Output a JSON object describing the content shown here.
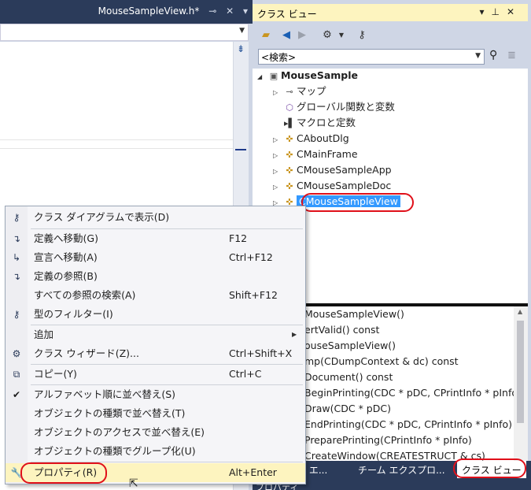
{
  "editor": {
    "tab_title": "MouseSampleView.h*",
    "pin_icon": "pin-icon",
    "close_icon": "close-icon"
  },
  "class_view": {
    "title": "クラス ビュー",
    "search_value": "<検索>",
    "tree": [
      {
        "label": "MouseSample",
        "icon": "project-icon"
      },
      {
        "label": "マップ",
        "icon": "key-icon"
      },
      {
        "label": "グローバル関数と変数",
        "icon": "cube-icon"
      },
      {
        "label": "マクロと定数",
        "icon": "macro-icon"
      },
      {
        "label": "CAboutDlg",
        "icon": "class-icon"
      },
      {
        "label": "CMainFrame",
        "icon": "class-icon"
      },
      {
        "label": "CMouseSampleApp",
        "icon": "class-icon"
      },
      {
        "label": "CMouseSampleDoc",
        "icon": "class-icon"
      },
      {
        "label": "CMouseSampleView",
        "icon": "class-icon"
      }
    ],
    "members": [
      "MouseSampleView()",
      "ertValid() const",
      "ouseSampleView()",
      "mp(CDumpContext & dc) const",
      "Document() const",
      "BeginPrinting(CDC * pDC, CPrintInfo * pInfo)",
      "Draw(CDC * pDC)",
      "EndPrinting(CDC * pDC, CPrintInfo * pInfo)",
      "PreparePrinting(CPrintInfo * pInfo)",
      "CreateWindow(CREATESTRUCT & cs)"
    ],
    "bottom_tabs": [
      "ョン エ...",
      "チーム エクスプロ...",
      "クラス ビュー"
    ],
    "properties_title": "プロパティ"
  },
  "context_menu": {
    "items": [
      {
        "label": "クラス ダイアグラムで表示(D)",
        "shortcut": "",
        "icon": "class-diagram-icon"
      },
      {
        "label": "定義へ移動(G)",
        "shortcut": "F12",
        "icon": "go-to-definition-icon"
      },
      {
        "label": "宣言へ移動(A)",
        "shortcut": "Ctrl+F12",
        "icon": "go-to-declaration-icon"
      },
      {
        "label": "定義の参照(B)",
        "shortcut": "",
        "icon": "browse-definition-icon"
      },
      {
        "label": "すべての参照の検索(A)",
        "shortcut": "Shift+F12",
        "icon": ""
      },
      {
        "label": "型のフィルター(I)",
        "shortcut": "",
        "icon": "type-filter-icon"
      },
      {
        "label": "追加",
        "shortcut": "",
        "icon": ""
      },
      {
        "label": "クラス ウィザード(Z)...",
        "shortcut": "Ctrl+Shift+X",
        "icon": "class-wizard-icon"
      },
      {
        "label": "コピー(Y)",
        "shortcut": "Ctrl+C",
        "icon": "copy-icon"
      },
      {
        "label": "アルファベット順に並べ替え(S)",
        "shortcut": "",
        "icon": "checkmark-icon"
      },
      {
        "label": "オブジェクトの種類で並べ替え(T)",
        "shortcut": "",
        "icon": ""
      },
      {
        "label": "オブジェクトのアクセスで並べ替え(E)",
        "shortcut": "",
        "icon": ""
      },
      {
        "label": "オブジェクトの種類でグループ化(U)",
        "shortcut": "",
        "icon": ""
      },
      {
        "label": "プロパティ(R)",
        "shortcut": "Alt+Enter",
        "icon": "wrench-icon"
      }
    ]
  },
  "colors": {
    "tab_bar": "#2b3b5a",
    "selection": "#3399ff",
    "highlight_ring": "#e0101a",
    "hover_row": "#fdf4bf"
  }
}
